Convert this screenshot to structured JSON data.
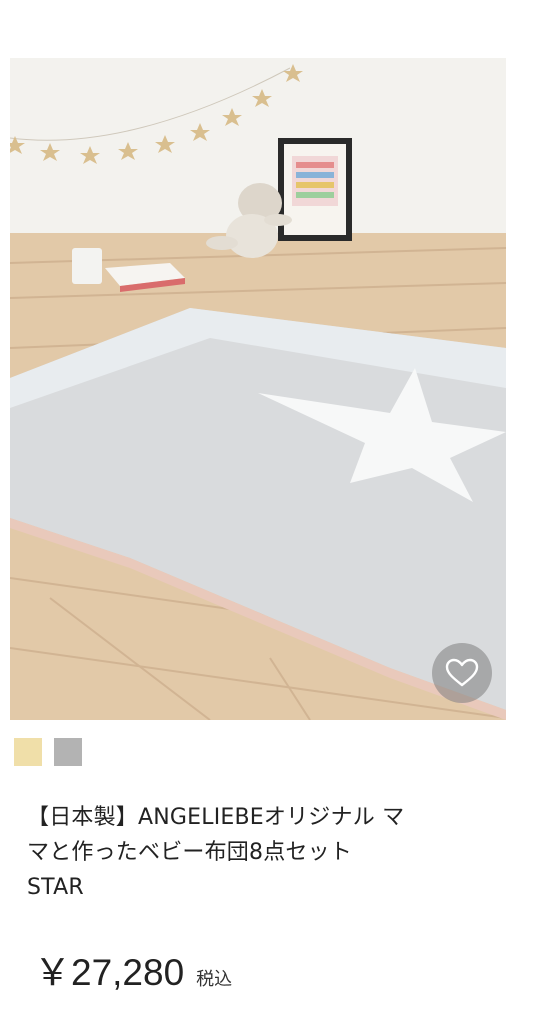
{
  "product": {
    "image_alt": "ANGELIEBE baby futon set STAR",
    "favorite_icon": "heart-outline-icon",
    "swatches": [
      {
        "color": "#f0dfa9"
      },
      {
        "color": "#b3b3b3"
      }
    ],
    "title_lines": [
      "【日本製】ANGELIEBEオリジナル マ",
      "マと作ったベビー布団8点セット",
      "STAR"
    ],
    "price": "￥27,280",
    "tax_label": "税込"
  }
}
